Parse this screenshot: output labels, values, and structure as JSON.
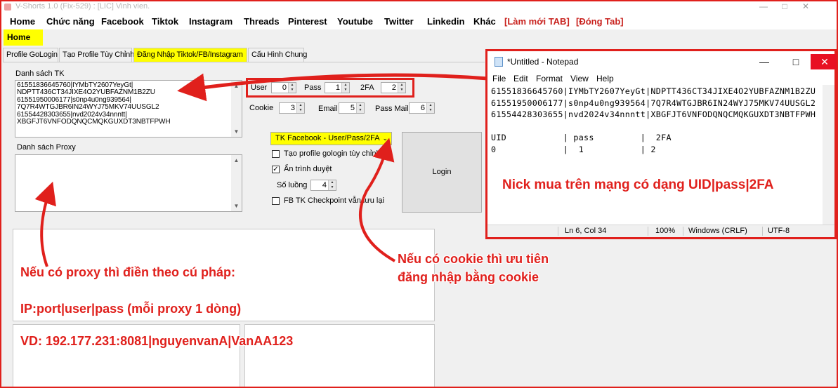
{
  "window": {
    "title": "V-Shorts 1.0 (Fix-529) : [LIC] Vinh vien.",
    "controls": [
      "—",
      "□",
      "✕"
    ]
  },
  "menu": {
    "items": [
      "Home",
      "Chức năng",
      "Facebook",
      "Tiktok",
      "Instagram",
      "Threads",
      "Pinterest",
      "Youtube",
      "Twitter",
      "Linkedin",
      "Khác"
    ],
    "refresh_tab": "[Làm mới TAB]",
    "close_tab": "[Đóng Tab]"
  },
  "home_tab": "Home",
  "subtabs": [
    "Profile GoLogin",
    "Tạo Profile Tùy Chỉnh",
    "Đăng Nhập Tiktok/FB/Instagram",
    "Cấu Hình Chung"
  ],
  "form": {
    "account_list_label": "Danh sách TK",
    "account_list_text": "61551836645760|IYMbTY2607YeyGt|\nNDPTT436CT34JIXE4O2YUBFAZNM1B2ZU\n61551950006177|s0np4u0ng939564|\n7Q7R4WTGJBR6IN24WYJ75MKV74UUSGL2\n61554428303655|nvd2024v34nnntt|\nXBGFJT6VNFODQNQCMQKGUXDT3NBTFPWH",
    "proxy_list_label": "Danh sách Proxy",
    "user_label": "User",
    "user_value": "0",
    "pass_label": "Pass",
    "pass_value": "1",
    "twofa_label": "2FA",
    "twofa_value": "2",
    "cookie_label": "Cookie",
    "cookie_value": "3",
    "email_label": "Email",
    "email_value": "5",
    "passmail_label": "Pass Mail",
    "passmail_value": "6",
    "format_select": "TK Facebook - User/Pass/2FA",
    "gologin_checkbox": "Tạo profile gologin tùy chỉnh",
    "hide_browser_checkbox": "Ẩn trình duyệt",
    "threads_label": "Số luồng",
    "threads_value": "4",
    "checkpoint_checkbox": "FB TK Checkpoint vẫn lưu lại",
    "login_button": "Login"
  },
  "annotations": {
    "proxy_line1": "Nếu có proxy thì điền theo cú pháp:",
    "proxy_line2": "IP:port|user|pass (mỗi proxy 1 dòng)",
    "proxy_line3": "VD: 192.177.231:8081|nguyenvanA|VanAA123",
    "cookie_line1": "Nếu có cookie thì ưu tiên",
    "cookie_line2": "đăng nhập bằng cookie",
    "nick_note": "Nick mua trên mạng có dạng UID|pass|2FA"
  },
  "notepad": {
    "title": "*Untitled - Notepad",
    "menu": [
      "File",
      "Edit",
      "Format",
      "View",
      "Help"
    ],
    "text": "61551836645760|IYMbTY2607YeyGt|NDPTT436CT34JIXE4O2YUBFAZNM1B2ZU\n61551950006177|s0np4u0ng939564|7Q7R4WTGJBR6IN24WYJ75MKV74UUSGL2\n61554428303655|nvd2024v34nnntt|XBGFJT6VNFODQNQCMQKGUXDT3NBTFPWH\n\nUID           | pass         |  2FA\n0             |  1           | 2",
    "status_pos": "Ln 6, Col 34",
    "status_zoom": "100%",
    "status_eol": "Windows (CRLF)",
    "status_enc": "UTF-8"
  },
  "colors": {
    "highlight": "#ffff00",
    "annotation": "#e0201c",
    "notepad_close": "#e81123"
  }
}
